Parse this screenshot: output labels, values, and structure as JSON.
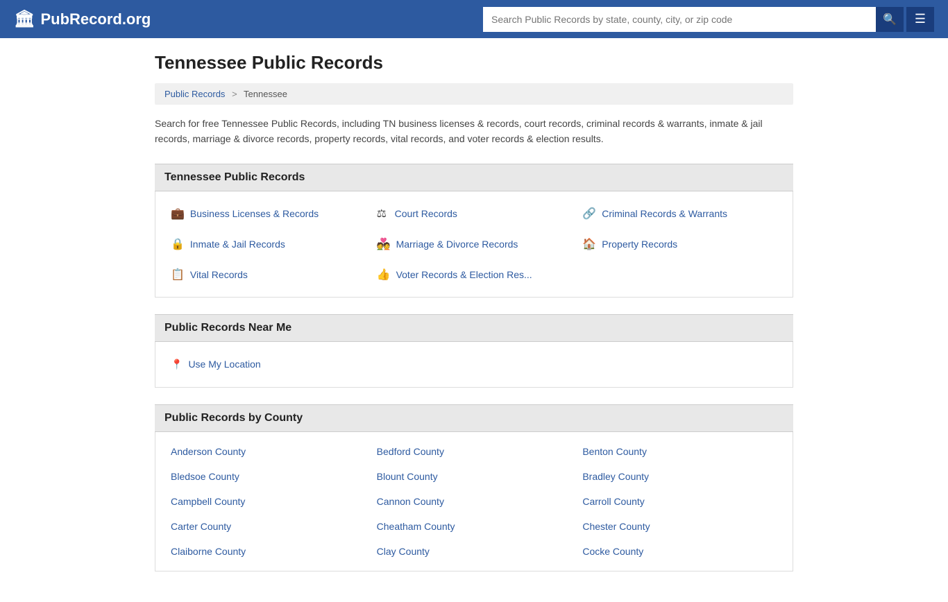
{
  "header": {
    "logo_icon": "🏛",
    "logo_text": "PubRecord.org",
    "search_placeholder": "Search Public Records by state, county, city, or zip code",
    "search_icon": "🔍",
    "menu_icon": "☰"
  },
  "page": {
    "title": "Tennessee Public Records",
    "breadcrumb": {
      "home_label": "Public Records",
      "separator": ">",
      "current": "Tennessee"
    },
    "description": "Search for free Tennessee Public Records, including TN business licenses & records, court records, criminal records & warrants, inmate & jail records, marriage & divorce records, property records, vital records, and voter records & election results."
  },
  "records_section": {
    "heading": "Tennessee Public Records",
    "items": [
      {
        "icon": "💼",
        "label": "Business Licenses & Records"
      },
      {
        "icon": "⚖",
        "label": "Court Records"
      },
      {
        "icon": "🔗",
        "label": "Criminal Records & Warrants"
      },
      {
        "icon": "🔒",
        "label": "Inmate & Jail Records"
      },
      {
        "icon": "💑",
        "label": "Marriage & Divorce Records"
      },
      {
        "icon": "🏠",
        "label": "Property Records"
      },
      {
        "icon": "📋",
        "label": "Vital Records"
      },
      {
        "icon": "👍",
        "label": "Voter Records & Election Res..."
      }
    ]
  },
  "near_me_section": {
    "heading": "Public Records Near Me",
    "item_icon": "📍",
    "item_label": "Use My Location"
  },
  "counties_section": {
    "heading": "Public Records by County",
    "counties": [
      "Anderson County",
      "Bedford County",
      "Benton County",
      "Bledsoe County",
      "Blount County",
      "Bradley County",
      "Campbell County",
      "Cannon County",
      "Carroll County",
      "Carter County",
      "Cheatham County",
      "Chester County",
      "Claiborne County",
      "Clay County",
      "Cocke County"
    ]
  }
}
